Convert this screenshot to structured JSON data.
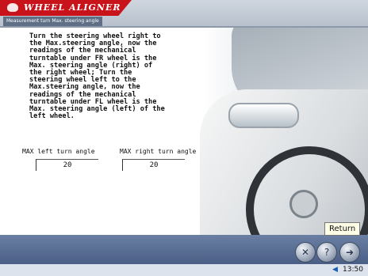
{
  "app": {
    "brand": "WHEEL ALIGNER",
    "subtitle": "Measurement turn Max. steering angle"
  },
  "instructions": "Turn the steering wheel right to\nthe Max.steering angle, now the\nreadings of the mechanical\nturntable under FR wheel is the\nMax. steering angle (right) of\nthe right wheel; Turn the\nsteering wheel left to the\nMax.steering angle, now the\nreadings of the mechanical\nturntable under FL wheel is the\nMax. steering angle (left) of the\nleft wheel.",
  "fields": {
    "left_label": "MAX left turn angle",
    "left_value": "20",
    "right_label": "MAX right turn angle",
    "right_value": "20"
  },
  "toolbar": {
    "tooltip": "Return",
    "tools_icon": "tools-icon",
    "help_icon": "help-icon",
    "return_icon": "return-icon"
  },
  "taskbar": {
    "clock": "13:50",
    "tray_icon": "volume-icon"
  }
}
